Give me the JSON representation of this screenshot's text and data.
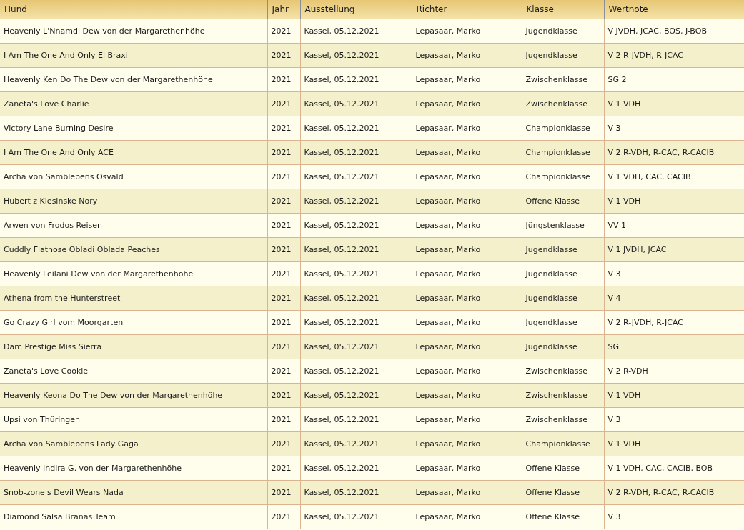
{
  "table": {
    "columns": [
      "Hund",
      "Jahr",
      "Ausstellung",
      "Richter",
      "Klasse",
      "Wertnote"
    ],
    "rows": [
      [
        "Heavenly L'Nnamdi Dew von der Margarethenhöhe",
        "2021",
        "Kassel, 05.12.2021",
        "Lepasaar, Marko",
        "Jugendklasse",
        "V JVDH, JCAC, BOS, J-BOB"
      ],
      [
        "I Am The One And Only El Braxi",
        "2021",
        "Kassel, 05.12.2021",
        "Lepasaar, Marko",
        "Jugendklasse",
        "V 2 R-JVDH, R-JCAC"
      ],
      [
        "Heavenly Ken Do The Dew von der Margarethenhöhe",
        "2021",
        "Kassel, 05.12.2021",
        "Lepasaar, Marko",
        "Zwischenklasse",
        "SG 2"
      ],
      [
        "Zaneta's Love Charlie",
        "2021",
        "Kassel, 05.12.2021",
        "Lepasaar, Marko",
        "Zwischenklasse",
        "V 1 VDH"
      ],
      [
        "Victory Lane Burning Desire",
        "2021",
        "Kassel, 05.12.2021",
        "Lepasaar, Marko",
        "Championklasse",
        "V 3"
      ],
      [
        "I Am The One And Only ACE",
        "2021",
        "Kassel, 05.12.2021",
        "Lepasaar, Marko",
        "Championklasse",
        "V 2 R-VDH, R-CAC, R-CACIB"
      ],
      [
        "Archa von Samblebens Osvald",
        "2021",
        "Kassel, 05.12.2021",
        "Lepasaar, Marko",
        "Championklasse",
        "V 1 VDH, CAC, CACIB"
      ],
      [
        "Hubert z Klesinske Nory",
        "2021",
        "Kassel, 05.12.2021",
        "Lepasaar, Marko",
        "Offene Klasse",
        "V 1 VDH"
      ],
      [
        "Arwen von Frodos Reisen",
        "2021",
        "Kassel, 05.12.2021",
        "Lepasaar, Marko",
        "Jüngstenklasse",
        "VV 1"
      ],
      [
        "Cuddly Flatnose Obladi Oblada Peaches",
        "2021",
        "Kassel, 05.12.2021",
        "Lepasaar, Marko",
        "Jugendklasse",
        "V 1 JVDH, JCAC"
      ],
      [
        "Heavenly Leilani Dew von der Margarethenhöhe",
        "2021",
        "Kassel, 05.12.2021",
        "Lepasaar, Marko",
        "Jugendklasse",
        "V 3"
      ],
      [
        "Athena from the Hunterstreet",
        "2021",
        "Kassel, 05.12.2021",
        "Lepasaar, Marko",
        "Jugendklasse",
        "V 4"
      ],
      [
        "Go Crazy Girl vom Moorgarten",
        "2021",
        "Kassel, 05.12.2021",
        "Lepasaar, Marko",
        "Jugendklasse",
        "V 2 R-JVDH, R-JCAC"
      ],
      [
        "Dam Prestige Miss Sierra",
        "2021",
        "Kassel, 05.12.2021",
        "Lepasaar, Marko",
        "Jugendklasse",
        "SG"
      ],
      [
        "Zaneta's Love Cookie",
        "2021",
        "Kassel, 05.12.2021",
        "Lepasaar, Marko",
        "Zwischenklasse",
        "V 2 R-VDH"
      ],
      [
        "Heavenly Keona Do The Dew von der Margarethenhöhe",
        "2021",
        "Kassel, 05.12.2021",
        "Lepasaar, Marko",
        "Zwischenklasse",
        "V 1 VDH"
      ],
      [
        "Upsi von Thüringen",
        "2021",
        "Kassel, 05.12.2021",
        "Lepasaar, Marko",
        "Zwischenklasse",
        "V 3"
      ],
      [
        "Archa von Samblebens Lady Gaga",
        "2021",
        "Kassel, 05.12.2021",
        "Lepasaar, Marko",
        "Championklasse",
        "V 1 VDH"
      ],
      [
        "Heavenly Indira G. von der Margarethenhöhe",
        "2021",
        "Kassel, 05.12.2021",
        "Lepasaar, Marko",
        "Offene Klasse",
        "V 1 VDH, CAC, CACIB, BOB"
      ],
      [
        "Snob-zone's Devil Wears Nada",
        "2021",
        "Kassel, 05.12.2021",
        "Lepasaar, Marko",
        "Offene Klasse",
        "V 2 R-VDH, R-CAC, R-CACIB"
      ],
      [
        "Diamond Salsa Branas Team",
        "2021",
        "Kassel, 05.12.2021",
        "Lepasaar, Marko",
        "Offene Klasse",
        "V 3"
      ]
    ]
  }
}
